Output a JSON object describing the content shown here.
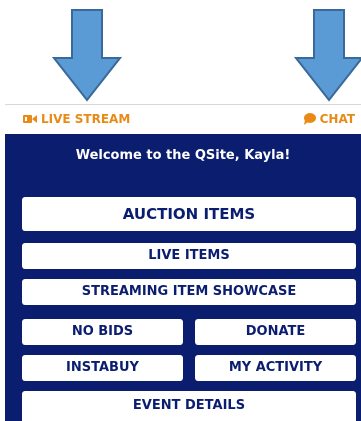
{
  "header": {
    "live_stream_label": "LIVE STREAM",
    "live_stream_icon": "video-camera-icon",
    "chat_label": "CHAT",
    "chat_icon": "chat-bubble-icon"
  },
  "panel": {
    "welcome_text": "Welcome to the QSite, Kayla!"
  },
  "menu": {
    "auction_items": "AUCTION ITEMS",
    "live_items": "LIVE ITEMS",
    "streaming_item_showcase": "STREAMING ITEM SHOWCASE",
    "no_bids": "NO BIDS",
    "donate": "DONATE",
    "instabuy": "INSTABUY",
    "my_activity": "MY ACTIVITY",
    "event_details": "EVENT DETAILS"
  },
  "annotations": {
    "arrow_icon": "down-arrow-icon",
    "arrow_color": "#5b9bd5",
    "arrow_outline": "#3a6a99"
  },
  "colors": {
    "accent": "#e98a17",
    "panel_background": "#0b1d6e",
    "button_background": "#ffffff",
    "button_text": "#0b1d6e"
  }
}
